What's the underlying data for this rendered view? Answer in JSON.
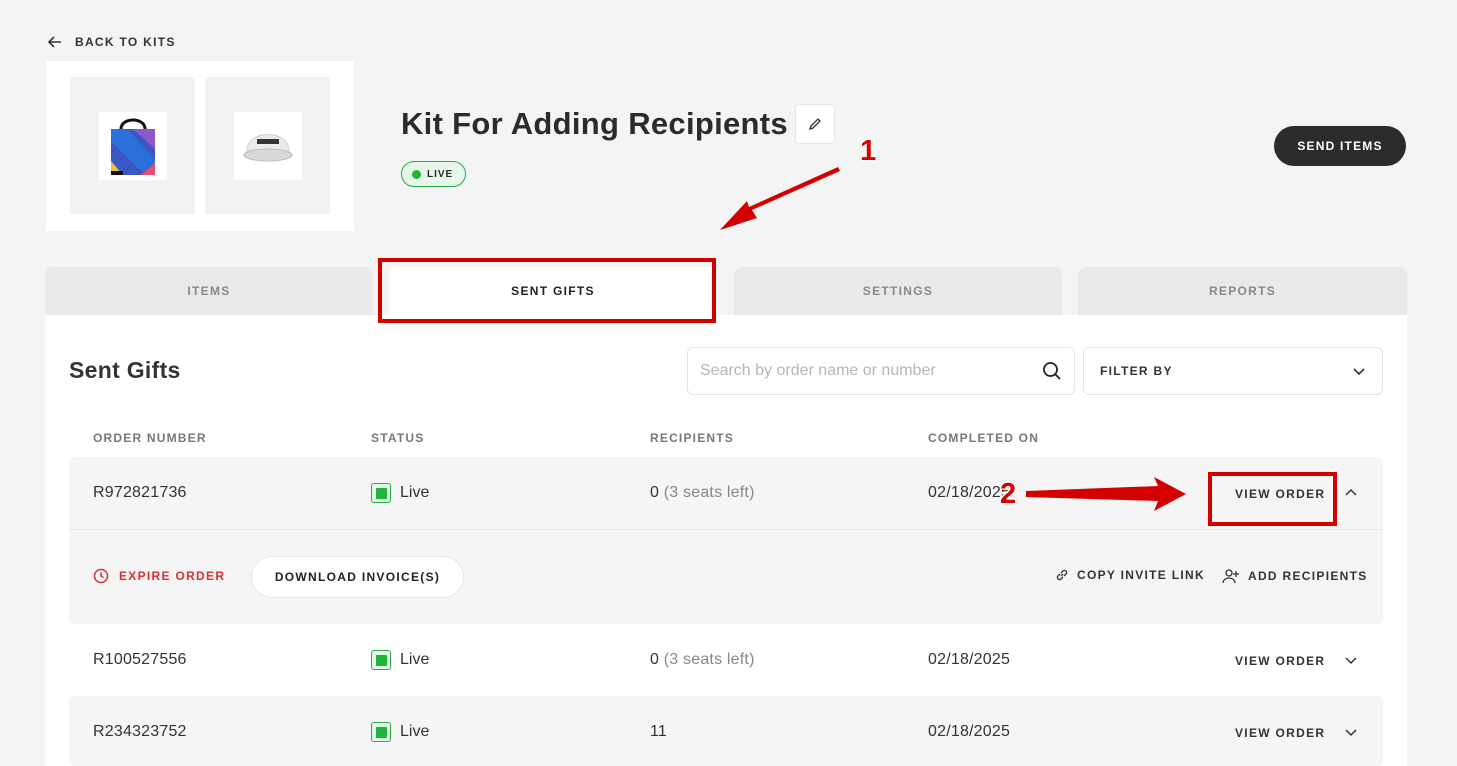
{
  "nav": {
    "back_label": "BACK TO KITS"
  },
  "kit": {
    "title": "Kit For Adding Recipients",
    "status_badge": "LIVE",
    "send_items_label": "SEND ITEMS",
    "thumbnails": [
      "tote-bag-image",
      "cap-image"
    ]
  },
  "tabs": [
    {
      "label": "ITEMS",
      "active": false
    },
    {
      "label": "SENT GIFTS",
      "active": true
    },
    {
      "label": "SETTINGS",
      "active": false
    },
    {
      "label": "REPORTS",
      "active": false
    }
  ],
  "sent_gifts": {
    "title": "Sent Gifts",
    "search_placeholder": "Search by order name or number",
    "filter_label": "FILTER BY",
    "columns": [
      "ORDER NUMBER",
      "STATUS",
      "RECIPIENTS",
      "COMPLETED ON"
    ],
    "rows": [
      {
        "order": "R972821736",
        "status": "Live",
        "recipients": "0",
        "seats": "(3 seats left)",
        "date": "02/18/2025",
        "action": "VIEW ORDER",
        "expanded": true
      },
      {
        "order": "R100527556",
        "status": "Live",
        "recipients": "0",
        "seats": "(3 seats left)",
        "date": "02/18/2025",
        "action": "VIEW ORDER",
        "expanded": false
      },
      {
        "order": "R234323752",
        "status": "Live",
        "recipients": "11",
        "seats": "",
        "date": "02/18/2025",
        "action": "VIEW ORDER",
        "expanded": false
      }
    ],
    "expanded_actions": {
      "expire": "EXPIRE ORDER",
      "download": "DOWNLOAD INVOICE(S)",
      "copy_link": "COPY INVITE LINK",
      "add_recipients": "ADD RECIPIENTS"
    }
  },
  "annotations": {
    "callout_1": "1",
    "callout_2": "2",
    "accent_color": "#d40000"
  },
  "colors": {
    "live_green": "#1fb53a",
    "danger_red": "#d93030",
    "dark_button": "#2b2b2b"
  }
}
